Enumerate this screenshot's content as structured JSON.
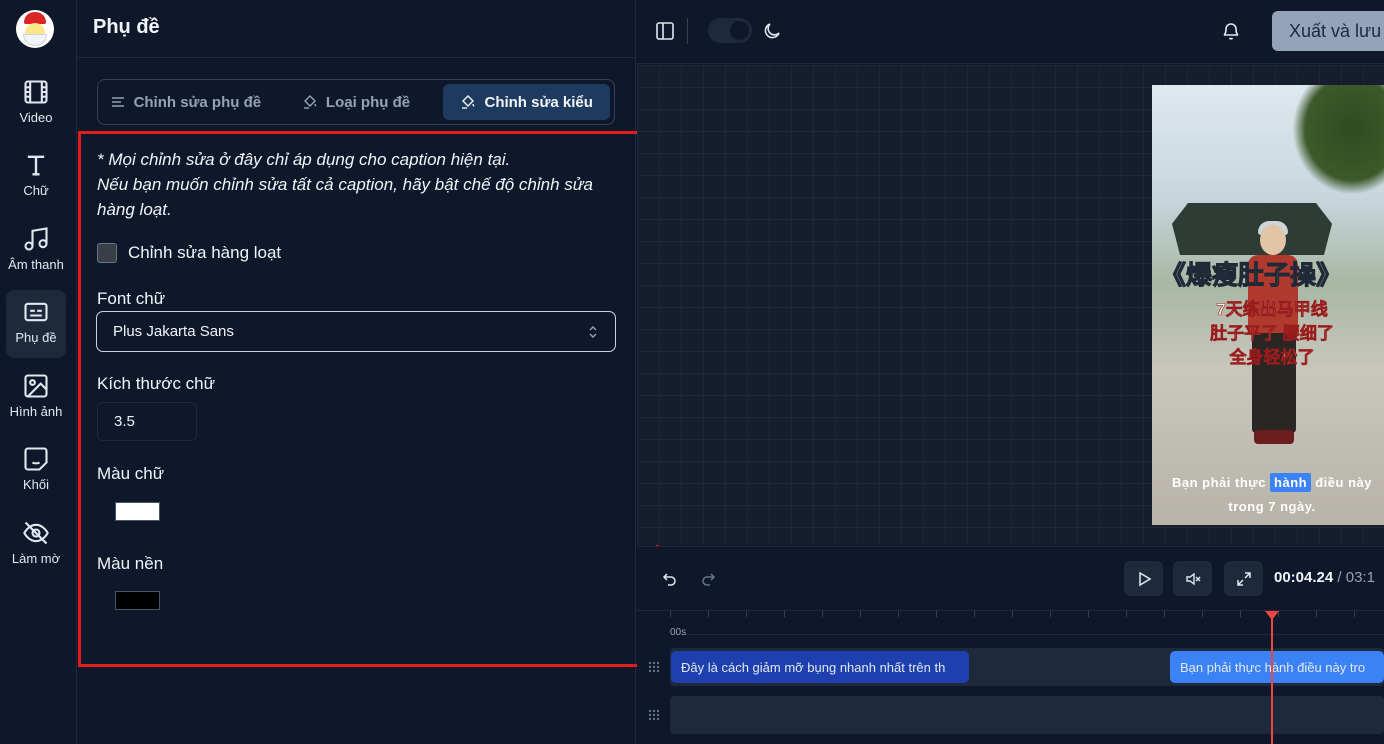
{
  "rail": {
    "items": [
      {
        "label": "Video",
        "icon": "film-icon"
      },
      {
        "label": "Chữ",
        "icon": "text-icon"
      },
      {
        "label": "Âm thanh",
        "icon": "music-icon"
      },
      {
        "label": "Phụ đề",
        "icon": "subtitles-icon"
      },
      {
        "label": "Hình ảnh",
        "icon": "image-icon"
      },
      {
        "label": "Khối",
        "icon": "sticker-icon"
      },
      {
        "label": "Làm mờ",
        "icon": "eye-off-icon"
      }
    ],
    "active_index": 3
  },
  "panel": {
    "title": "Phụ đề",
    "tabs": [
      {
        "label": "Chỉnh sửa phụ đề",
        "icon": "align-left-icon"
      },
      {
        "label": "Loại phụ đề",
        "icon": "paint-bucket-icon"
      },
      {
        "label": "Chỉnh sửa kiểu",
        "icon": "paint-bucket-icon"
      }
    ],
    "active_tab_index": 2,
    "note_line1": "* Mọi chỉnh sửa ở đây chỉ áp dụng cho caption hiện tại.",
    "note_line2": "Nếu bạn muốn chỉnh sửa tất cả caption, hãy bật chế độ chỉnh sửa hàng loạt.",
    "bulk_edit_label": "Chỉnh sửa hàng loạt",
    "bulk_edit_checked": false,
    "font_label": "Font chữ",
    "font_value": "Plus Jakarta Sans",
    "size_label": "Kích thước chữ",
    "size_value": "3.5",
    "text_color_label": "Màu chữ",
    "text_color": "#ffffff",
    "bg_color_label": "Màu nền",
    "bg_color": "#000000"
  },
  "topbar": {
    "export_label": "Xuất và lưu"
  },
  "preview": {
    "title": "《爆瘦肚子操》",
    "sub_lines": [
      "7天练出马甲线",
      "肚子平了 腰细了",
      "全身轻松了"
    ],
    "caption_before": "Bạn phải thực",
    "caption_highlight": "hành",
    "caption_after": "điều này",
    "caption_line2": "trong 7 ngày."
  },
  "controls": {
    "time_current": "00:04.24",
    "time_total": "03:1"
  },
  "timeline": {
    "ruler_start": "00s",
    "clips": [
      {
        "text": "Đây là cách giảm mỡ bụng nhanh nhất trên th",
        "color": "#1e40af"
      },
      {
        "text": "Bạn phải thực hành điều này tro",
        "color": "#3b82f6"
      }
    ]
  }
}
